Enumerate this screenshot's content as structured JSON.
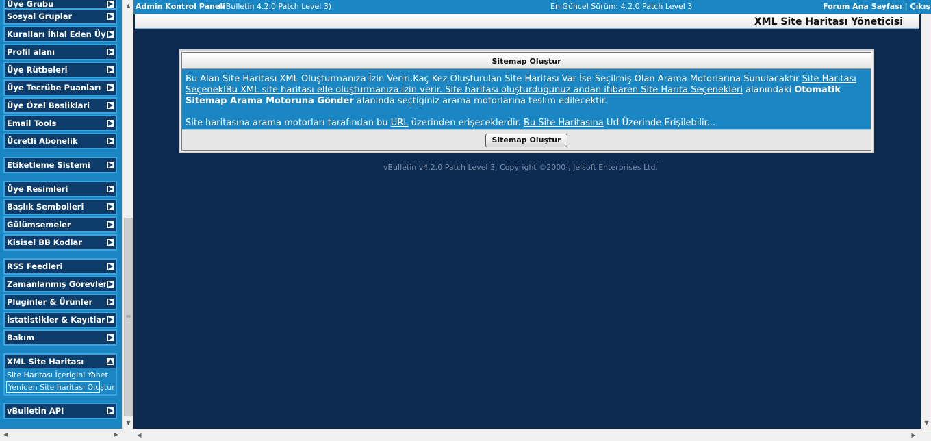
{
  "sidebar": {
    "groups": [
      {
        "label": "Üye Grubu",
        "state": "collapsed"
      },
      {
        "label": "Sosyal Gruplar",
        "state": "collapsed"
      },
      {
        "label": "Kuralları İhlal Eden Üyeler",
        "state": "collapsed"
      },
      {
        "label": "Profil alanı",
        "state": "collapsed"
      },
      {
        "label": "Üye Rütbeleri",
        "state": "collapsed"
      },
      {
        "label": "Üye Tecrübe Puanları",
        "state": "collapsed"
      },
      {
        "label": "Üye Özel Basliklari",
        "state": "collapsed"
      },
      {
        "label": "Email Tools",
        "state": "collapsed"
      },
      {
        "label": "Ücretli Abonelik",
        "state": "collapsed"
      },
      {
        "label": "Etiketleme Sistemi",
        "state": "collapsed"
      },
      {
        "label": "Üye Resimleri",
        "state": "collapsed"
      },
      {
        "label": "Başlık Sembolleri",
        "state": "collapsed"
      },
      {
        "label": "Gülümsemeler",
        "state": "collapsed"
      },
      {
        "label": "Kisisel BB Kodlar",
        "state": "collapsed"
      },
      {
        "label": "RSS Feedleri",
        "state": "collapsed"
      },
      {
        "label": "Zamanlanmış Görevler",
        "state": "collapsed"
      },
      {
        "label": "Pluginler & Ürünler",
        "state": "collapsed"
      },
      {
        "label": "İstatistikler & Kayıtlar",
        "state": "collapsed"
      },
      {
        "label": "Bakım",
        "state": "collapsed"
      },
      {
        "label": "XML Site Haritası",
        "state": "expanded",
        "links": [
          "Site Haritası İçerigini Yönet",
          "Yeniden Site haritası Oluştur"
        ]
      },
      {
        "label": "vBulletin API",
        "state": "collapsed"
      }
    ],
    "expand_icon": "arrow-right-icon",
    "collapse_icon": "arrow-up-icon"
  },
  "topbar": {
    "cp_title": "Admin Kontrol Paneli",
    "cp_version": "(vBulletin 4.2.0 Patch Level 3)",
    "latest_version": "En Güncel Sürüm: 4.2.0 Patch Level 3",
    "forum_home": "Forum Ana Sayfası",
    "separator": "|",
    "logout": "Çıkış"
  },
  "page": {
    "title": "XML Site Haritası Yöneticisi"
  },
  "panel": {
    "heading": "Sitemap Oluştur",
    "p1_text1": "Bu Alan Site Haritası XML Oluşturmanıza İzin Veriri.Kaç Kez Oluşturulan Site Haritası Var İse Seçilmiş Olan Arama Motorlarına Sunulacaktır ",
    "p1_link": "Site Haritası SeçeneklBu XML site haritası elle oluşturmanıza izin verir. Site haritası oluşturduğunuz andan itibaren Site Harıta Seçenekleri",
    "p1_text2": " alanındaki ",
    "p1_bold": "Otomatik Sitemap Arama Motoruna Gönder",
    "p1_text3": " alanında seçtiğiniz arama motorlarına teslim edilecektir.",
    "p2_text1": "Site haritasına arama motorları tarafından bu ",
    "p2_link1": "URL",
    "p2_text2": " üzerinden erişeceklerdir. ",
    "p2_link2": "Bu Site Haritasına",
    "p2_text3": " Url Üzerinde Erişilebilir...",
    "button": "Sitemap Oluştur"
  },
  "footer": {
    "copyright": "vBulletin v4.2.0 Patch Level 3, Copyright ©2000-, Jelsoft Enterprises Ltd."
  },
  "colors": {
    "nav_background": "#1a86c4",
    "nav_group": "#0d3c6b",
    "main_background": "#0d2a50",
    "panel_body": "#1a86c4"
  }
}
